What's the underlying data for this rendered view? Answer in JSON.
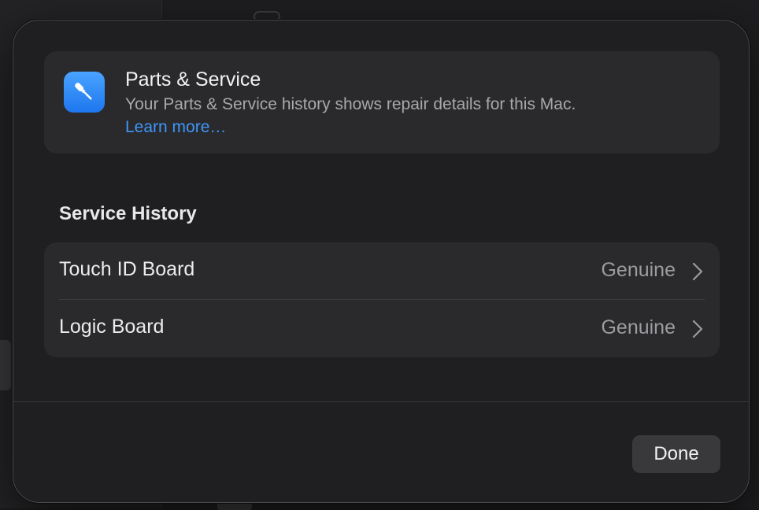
{
  "info": {
    "title": "Parts & Service",
    "description": "Your Parts & Service history shows repair details for this Mac.",
    "link": "Learn more…",
    "icon": "screwdriver-icon"
  },
  "section": {
    "title": "Service History"
  },
  "items": [
    {
      "label": "Touch ID Board",
      "status": "Genuine"
    },
    {
      "label": "Logic Board",
      "status": "Genuine"
    }
  ],
  "footer": {
    "done_label": "Done"
  },
  "colors": {
    "accent": "#3f95f8",
    "icon_gradient_top": "#4aa3ff",
    "icon_gradient_bottom": "#1d77ee"
  }
}
